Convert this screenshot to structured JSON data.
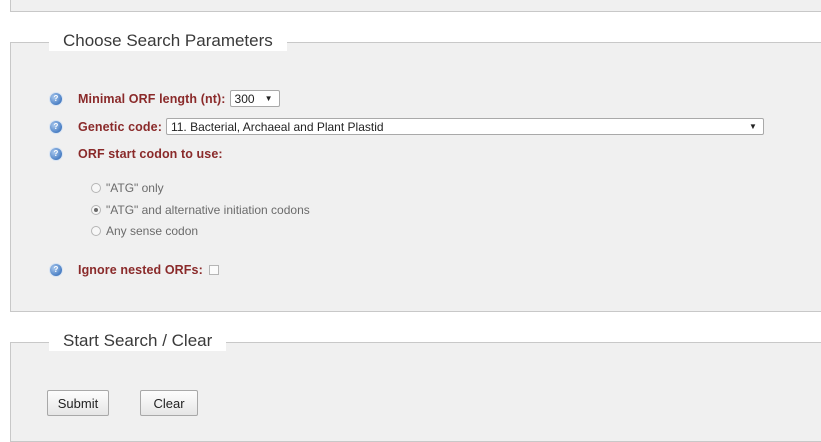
{
  "params": {
    "legend": "Choose Search Parameters",
    "min_orf": {
      "label": "Minimal ORF length (nt):",
      "value": "300"
    },
    "genetic_code": {
      "label": "Genetic code:",
      "value": "11. Bacterial, Archaeal and Plant Plastid"
    },
    "start_codon": {
      "label": "ORF start codon to use:",
      "options": [
        "\"ATG\" only",
        "\"ATG\" and alternative initiation codons",
        "Any sense codon"
      ],
      "selected_index": 1
    },
    "ignore_nested": {
      "label": "Ignore nested ORFs:",
      "checked": false
    }
  },
  "actions": {
    "legend": "Start Search / Clear",
    "submit_label": "Submit",
    "clear_label": "Clear"
  },
  "icons": {
    "help": "help-icon",
    "dropdown": "chevron-down-icon"
  },
  "colors": {
    "label": "#8a2a2a",
    "panel_bg": "#f0f0f0",
    "help_icon": "#4a7fc4"
  }
}
